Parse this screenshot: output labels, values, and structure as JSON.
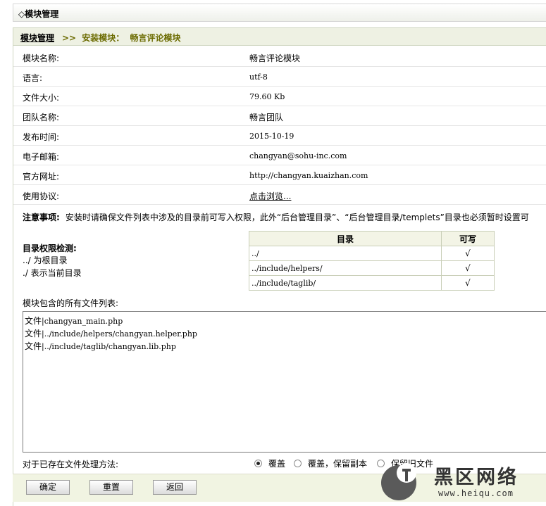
{
  "header": {
    "title": "◇模块管理"
  },
  "breadcrumb": {
    "home": "模块管理",
    "sep": ">>",
    "step": "安装模块：",
    "module": "畅言评论模块"
  },
  "info_rows": [
    {
      "label": "模块名称:",
      "value": "畅言评论模块"
    },
    {
      "label": "语言:",
      "value": "utf-8"
    },
    {
      "label": "文件大小:",
      "value": "79.60 Kb"
    },
    {
      "label": "团队名称:",
      "value": "畅言团队"
    },
    {
      "label": "发布时间:",
      "value": "2015-10-19"
    },
    {
      "label": "电子邮箱:",
      "value": "changyan@sohu-inc.com"
    },
    {
      "label": "官方网址:",
      "value": "http://changyan.kuaizhan.com"
    },
    {
      "label": "使用协议:",
      "value": "点击浏览..."
    }
  ],
  "notice": {
    "label": "注意事项:",
    "text": "安装时请确保文件列表中涉及的目录前可写入权限，此外“后台管理目录”、“后台管理目录/templets”目录也必须暂时设置可"
  },
  "perm": {
    "title": "目录权限检测:",
    "line1": "../ 为根目录",
    "line2": "./ 表示当前目录",
    "headers": [
      "目录",
      "可写"
    ],
    "rows": [
      {
        "dir": "../",
        "writable": "√"
      },
      {
        "dir": "../include/helpers/",
        "writable": "√"
      },
      {
        "dir": "../include/taglib/",
        "writable": "√"
      }
    ]
  },
  "files": {
    "label": "模块包含的所有文件列表:",
    "items": [
      {
        "type": "文件",
        "path": "|changyan_main.php"
      },
      {
        "type": "文件",
        "path": "|../include/helpers/changyan.helper.php"
      },
      {
        "type": "文件",
        "path": "|../include/taglib/changyan.lib.php"
      }
    ]
  },
  "method": {
    "label": "对于已存在文件处理方法:",
    "options": [
      "覆盖",
      "覆盖，保留副本",
      "保留旧文件"
    ],
    "selected": "覆盖"
  },
  "buttons": {
    "confirm": "确定",
    "reset": "重置",
    "back": "返回"
  },
  "watermark": {
    "text": "黑区网络",
    "url": "www.heiqu.com"
  }
}
